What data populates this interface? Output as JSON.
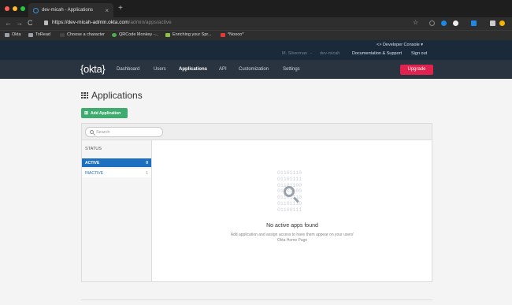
{
  "browser": {
    "tab_title": "dev-micah - Applications",
    "tab_close": "×",
    "new_tab": "+",
    "nav": {
      "back": "←",
      "forward": "→",
      "reload": "C"
    },
    "url_host": "https://dev-micah-admin.okta.com",
    "url_path": "/admin/apps/active",
    "bookmarks": [
      {
        "label": "Okta",
        "color": "#9aa0a6"
      },
      {
        "label": "ToRead",
        "color": "#9aa0a6"
      },
      {
        "label": "Choose a character",
        "color": "#2e2e2e"
      },
      {
        "label": "QRCode Monkey -...",
        "color": "#4caf50"
      },
      {
        "label": "Enriching your Spr...",
        "color": "#8bc34a"
      },
      {
        "label": "*Noooo*",
        "color": "#e53935"
      }
    ]
  },
  "okta": {
    "dev_console": "<> Developer Console ▾",
    "user_name": "M. Silverman",
    "org_name": "dev-micah",
    "support_link": "Documentation & Support",
    "signout_link": "Sign out",
    "logo": "{okta}",
    "nav": [
      "Dashboard",
      "Users",
      "Applications",
      "API",
      "Customization",
      "Settings"
    ],
    "active_nav": "Applications",
    "upgrade": "Upgrade"
  },
  "page": {
    "title": "Applications",
    "add_button": "Add Application",
    "search_placeholder": "Search",
    "status_label": "STATUS",
    "statuses": [
      {
        "label": "ACTIVE",
        "count": "0"
      },
      {
        "label": "INACTIVE",
        "count": "1"
      }
    ],
    "binary_lines": [
      "01101110",
      "01101111",
      "01101100",
      "01101100",
      "01101110",
      "01101110",
      "01100111"
    ],
    "empty_title": "No active apps found",
    "empty_desc_1": "Add application and assign access to have them appear on your users'",
    "empty_desc_2": "Okta Home Page"
  },
  "colors": {
    "okta_header": "#1b2a3a",
    "okta_nav": "#2a3340",
    "upgrade": "#e0234e",
    "add_button": "#3fab6e",
    "active_status": "#1d6fbf"
  }
}
